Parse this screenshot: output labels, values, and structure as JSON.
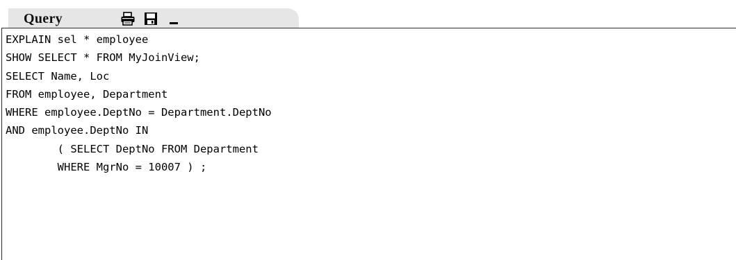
{
  "panel": {
    "tab_title": "Query",
    "tools": [
      {
        "name": "print-icon",
        "label": "Print"
      },
      {
        "name": "save-icon",
        "label": "Save"
      },
      {
        "name": "minimize-icon",
        "label": "Minimize"
      }
    ]
  },
  "editor": {
    "lines": [
      "EXPLAIN sel * employee",
      "SHOW SELECT * FROM MyJoinView;",
      "SELECT Name, Loc",
      "FROM employee, Department",
      "WHERE employee.DeptNo = Department.DeptNo",
      "AND employee.DeptNo IN",
      "        ( SELECT DeptNo FROM Department",
      "        WHERE MgrNo = 10007 ) ;"
    ]
  },
  "colors": {
    "tab_background": "#e6e6e6",
    "editor_border": "#2b2b2b",
    "text": "#000000"
  }
}
